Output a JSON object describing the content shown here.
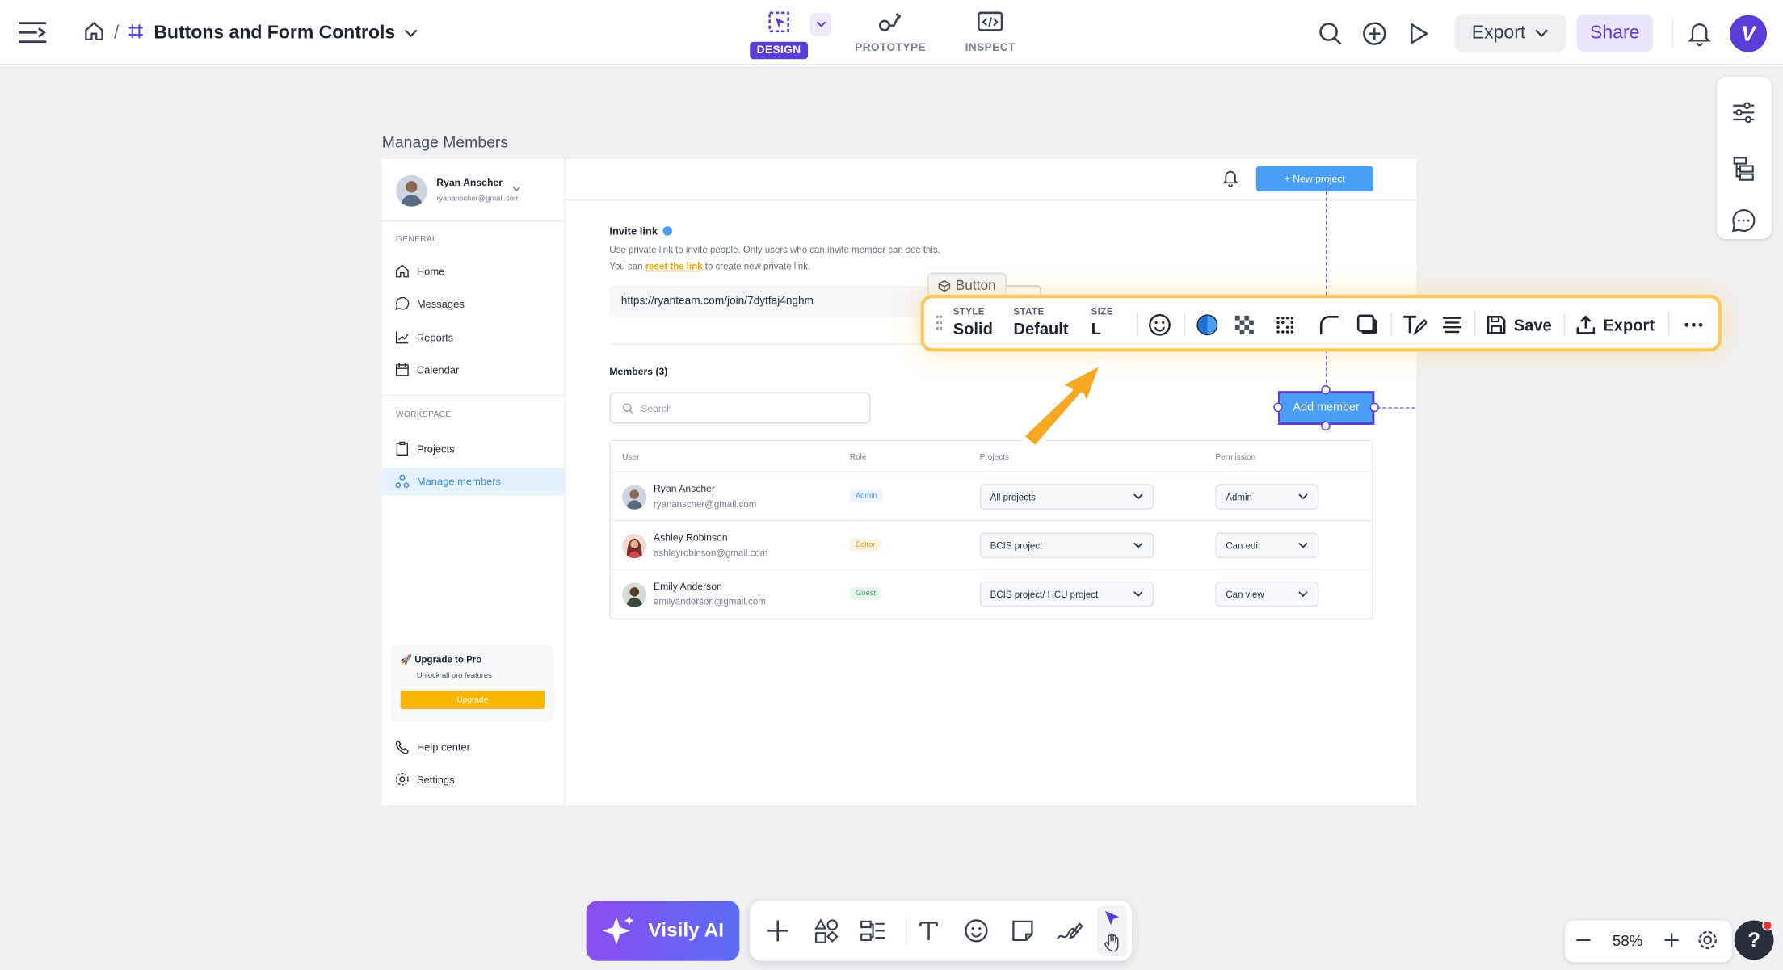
{
  "app": {
    "breadcrumb_title": "Buttons and Form Controls",
    "modes": [
      "DESIGN",
      "PROTOTYPE",
      "INSPECT"
    ],
    "export_label": "Export",
    "share_label": "Share",
    "avatar_letter": "V"
  },
  "frame": {
    "title": "Manage Members",
    "profile": {
      "name": "Ryan Anscher",
      "email": "ryananscher@gmail.com"
    },
    "sections": {
      "general": "GENERAL",
      "workspace": "WORKSPACE"
    },
    "nav": {
      "home": "Home",
      "messages": "Messages",
      "reports": "Reports",
      "calendar": "Calendar",
      "projects": "Projects",
      "manage": "Manage members",
      "help": "Help center",
      "settings": "Settings"
    },
    "upgrade": {
      "title": "🚀 Upgrade to Pro",
      "desc": "Unlock all pro features",
      "button": "Upgrade"
    },
    "new_project": "+ New project",
    "invite": {
      "title": "Invite link",
      "line1": "Use private link to invite people. Only users who can invite member can see this.",
      "line2_pre": "You can ",
      "line2_link": "reset the link",
      "line2_post": " to create new private link.",
      "url": "https://ryanteam.com/join/7dytfaj4nghm"
    },
    "members_title": "Members (3)",
    "search_placeholder": "Search",
    "add_member": "Add member",
    "columns": {
      "user": "User",
      "role": "Role",
      "projects": "Projects",
      "permission": "Permission"
    },
    "rows": [
      {
        "name": "Ryan Anscher",
        "email": "ryananscher@gmail.com",
        "role": "Admin",
        "project": "All projects",
        "permission": "Admin"
      },
      {
        "name": "Ashley Robinson",
        "email": "ashleyrobinson@gmail.com",
        "role": "Editor",
        "project": "BCIS project",
        "permission": "Can edit"
      },
      {
        "name": "Emily Anderson",
        "email": "emilyanderson@gmail.com",
        "role": "Guest",
        "project": "BCIS project/ HCU project",
        "permission": "Can view"
      }
    ]
  },
  "component_label": "Button",
  "toolbar": {
    "style_key": "STYLE",
    "style_val": "Solid",
    "state_key": "STATE",
    "state_val": "Default",
    "size_key": "SIZE",
    "size_val": "L",
    "save": "Save",
    "export": "Export"
  },
  "bottom": {
    "ai_label": "Visily AI",
    "zoom": "58%"
  },
  "colors": {
    "accent": "#5a3dd6",
    "primary_blue": "#4a9ff5",
    "highlight": "#ffc85c",
    "upgrade": "#f7b500"
  }
}
